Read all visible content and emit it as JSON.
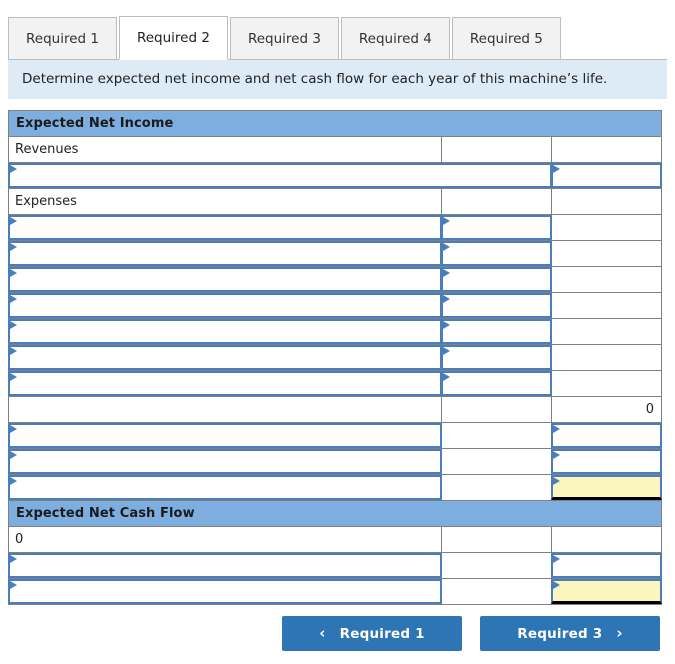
{
  "tabs": [
    {
      "label": "Required 1",
      "active": false
    },
    {
      "label": "Required 2",
      "active": true
    },
    {
      "label": "Required 3",
      "active": false
    },
    {
      "label": "Required 4",
      "active": false
    },
    {
      "label": "Required 5",
      "active": false
    }
  ],
  "instruction": "Determine expected net income and net cash flow for each year of this machine’s life.",
  "colors": {
    "section_header_bg": "#7eaee0",
    "banner_bg": "#ddebf7",
    "input_border": "#4a7ebb",
    "total_cell_bg": "#faf6bd",
    "button_bg": "#2e75b6",
    "tab_inactive_bg": "#f2f2f2",
    "tab_active_bg": "#ffffff",
    "grid_border": "#808080"
  },
  "sections": [
    {
      "id": "expected-net-income",
      "title": "Expected Net Income",
      "rows": [
        {
          "kind": "label",
          "label": "Revenues",
          "col2": "",
          "col3": ""
        },
        {
          "kind": "input-merged",
          "label": "",
          "col3_input": true
        },
        {
          "kind": "label",
          "label": "Expenses",
          "col2": "",
          "col3": ""
        },
        {
          "kind": "input-c1c2",
          "label": ""
        },
        {
          "kind": "input-c1c2",
          "label": ""
        },
        {
          "kind": "input-c1c2",
          "label": ""
        },
        {
          "kind": "input-c1c2",
          "label": ""
        },
        {
          "kind": "input-c1c2",
          "label": ""
        },
        {
          "kind": "input-c1c2",
          "label": ""
        },
        {
          "kind": "input-c1c2",
          "label": ""
        },
        {
          "kind": "total-static",
          "label": "",
          "col2": "",
          "col3": "0"
        },
        {
          "kind": "input-c1c3",
          "label": ""
        },
        {
          "kind": "input-c1c3",
          "label": ""
        },
        {
          "kind": "input-c1c3-yellow",
          "label": ""
        }
      ]
    },
    {
      "id": "expected-net-cash-flow",
      "title": "Expected Net Cash Flow",
      "rows": [
        {
          "kind": "label",
          "label": "0",
          "col2": "",
          "col3": ""
        },
        {
          "kind": "input-c1c3",
          "label": ""
        },
        {
          "kind": "input-c1c3-yellow",
          "label": ""
        }
      ]
    }
  ],
  "footer": {
    "prev_label": "Required 1",
    "prev_icon": "chevron-left-icon",
    "prev_glyph": "‹",
    "next_label": "Required 3",
    "next_icon": "chevron-right-icon",
    "next_glyph": "›"
  }
}
